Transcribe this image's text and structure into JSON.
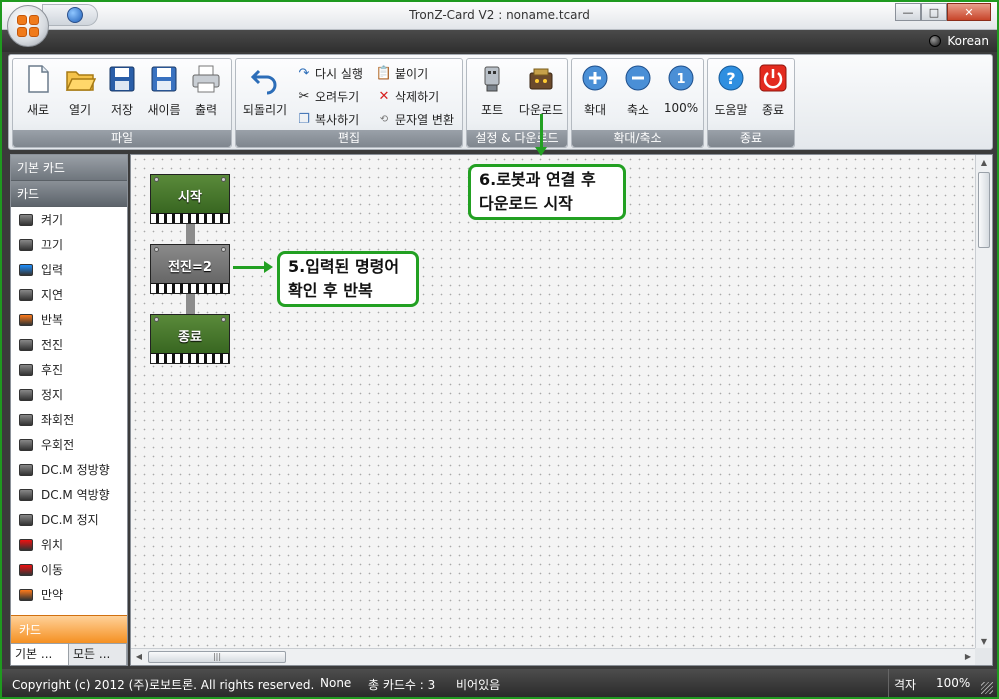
{
  "window": {
    "title": "TronZ-Card V2 : noname.tcard",
    "language": "Korean",
    "btn_minimize": "—",
    "btn_maximize": "□",
    "btn_close": "✕"
  },
  "ribbon": {
    "file": {
      "label": "파일",
      "new": "새로",
      "open": "열기",
      "save": "저장",
      "save_as": "새이름",
      "print": "출력"
    },
    "edit": {
      "label": "편집",
      "undo": "되돌리기",
      "redo": "다시 실행",
      "cut": "오려두기",
      "copy": "복사하기",
      "paste": "붙이기",
      "delete": "삭제하기",
      "string_convert": "문자열 변환"
    },
    "setup": {
      "label": "설정 & 다운로드",
      "port": "포트",
      "download": "다운로드"
    },
    "zoom": {
      "label": "확대/축소",
      "zoom_in": "확대",
      "zoom_out": "축소",
      "zoom_100": "100%"
    },
    "exit": {
      "label": "종료",
      "help": "도움말",
      "quit": "종료"
    }
  },
  "sidebar": {
    "header": "기본 카드",
    "subheader": "카드",
    "items": [
      {
        "label": "켜기",
        "color": "#888888"
      },
      {
        "label": "끄기",
        "color": "#888888"
      },
      {
        "label": "입력",
        "color": "#1e90ff"
      },
      {
        "label": "지연",
        "color": "#888888"
      },
      {
        "label": "반복",
        "color": "#ff7a1a"
      },
      {
        "label": "전진",
        "color": "#888888"
      },
      {
        "label": "후진",
        "color": "#888888"
      },
      {
        "label": "정지",
        "color": "#888888"
      },
      {
        "label": "좌회전",
        "color": "#888888"
      },
      {
        "label": "우회전",
        "color": "#888888"
      },
      {
        "label": "DC.M 정방향",
        "color": "#888888"
      },
      {
        "label": "DC.M 역방향",
        "color": "#888888"
      },
      {
        "label": "DC.M 정지",
        "color": "#888888"
      },
      {
        "label": "위치",
        "color": "#ee1111"
      },
      {
        "label": "이동",
        "color": "#ee1111"
      },
      {
        "label": "만약",
        "color": "#ff7a1a"
      }
    ],
    "footer": "카드",
    "tabs": [
      "기본 ...",
      "모든 ..."
    ]
  },
  "canvas": {
    "cards": [
      {
        "label": "시작",
        "style": "green"
      },
      {
        "label": "전진=2",
        "style": "gray"
      },
      {
        "label": "종료",
        "style": "green"
      }
    ],
    "callout5": [
      "5.입력된 명령어",
      "확인 후 반복"
    ],
    "callout6": [
      "6.로봇과 연결 후",
      "다운로드 시작"
    ]
  },
  "status": {
    "copyright": "Copyright (c) 2012 (주)로보트론.  All rights reserved.",
    "mode": "None",
    "card_count": "총 카드수 : 3",
    "state": "비어있음",
    "grid": "격자",
    "zoom": "100%"
  }
}
